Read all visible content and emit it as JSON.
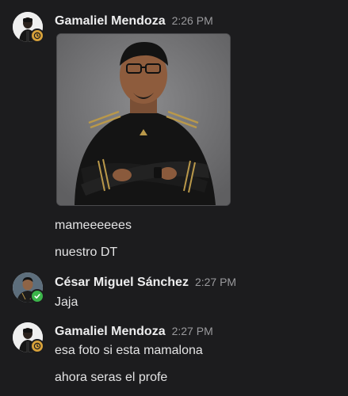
{
  "messages": [
    {
      "sender": "Gamaliel Mendoza",
      "time": "2:26 PM",
      "status": "away",
      "has_image": true,
      "lines": [
        "mameeeeees",
        "nuestro DT"
      ]
    },
    {
      "sender": "César Miguel Sánchez",
      "time": "2:27 PM",
      "status": "online",
      "lines": [
        "Jaja"
      ]
    },
    {
      "sender": "Gamaliel Mendoza",
      "time": "2:27 PM",
      "status": "away",
      "lines": [
        "esa foto si esta mamalona",
        "ahora seras el profe"
      ]
    }
  ],
  "colors": {
    "background": "#1c1c1e",
    "away": "#d7a13a",
    "online": "#3bb54a"
  }
}
